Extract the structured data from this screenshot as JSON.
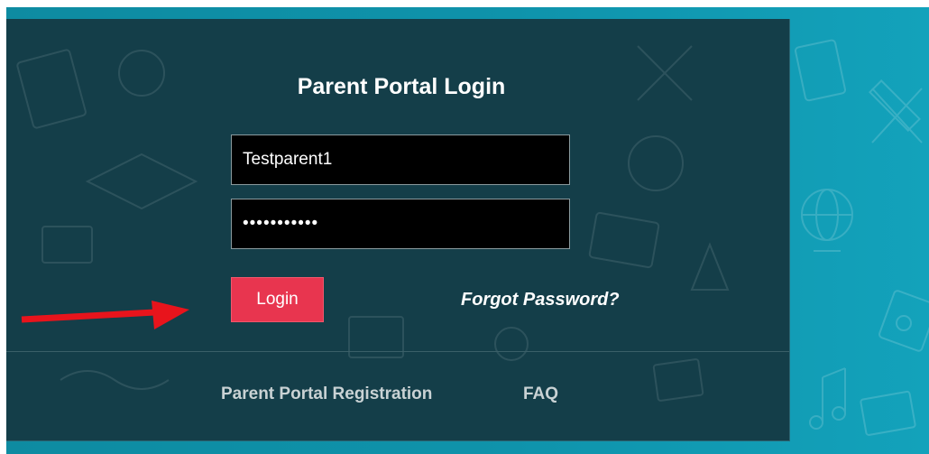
{
  "login_panel": {
    "title": "Parent Portal Login",
    "username_value": "Testparent1",
    "password_value": "•••••••••••",
    "login_label": "Login",
    "forgot_label": "Forgot Password?"
  },
  "footer": {
    "registration_label": "Parent Portal Registration",
    "faq_label": "FAQ"
  },
  "annotation": {
    "arrow_icon": "red-arrow-icon",
    "color": "#e8141c"
  },
  "colors": {
    "background": "#0f93ab",
    "panel": "#143e49",
    "login_button": "#e8354f"
  }
}
